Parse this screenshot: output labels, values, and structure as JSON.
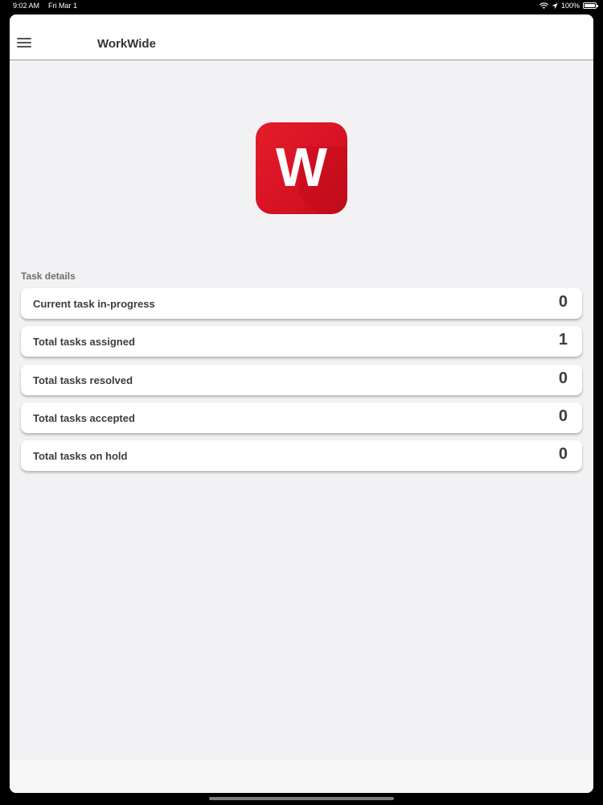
{
  "status_bar": {
    "time": "9:02 AM",
    "date": "Fri Mar 1",
    "battery": "100%",
    "icons": [
      "wifi-icon",
      "location-icon",
      "battery-icon"
    ]
  },
  "header": {
    "title": "WorkWide",
    "menu_icon": "menu-icon"
  },
  "logo": {
    "letter": "W",
    "color": "#d81324"
  },
  "task_details": {
    "section_label": "Task details",
    "items": [
      {
        "label": "Current task in-progress",
        "count": "0"
      },
      {
        "label": "Total tasks assigned",
        "count": "1"
      },
      {
        "label": "Total tasks resolved",
        "count": "0"
      },
      {
        "label": "Total tasks accepted",
        "count": "0"
      },
      {
        "label": "Total tasks on hold",
        "count": "0"
      }
    ]
  }
}
